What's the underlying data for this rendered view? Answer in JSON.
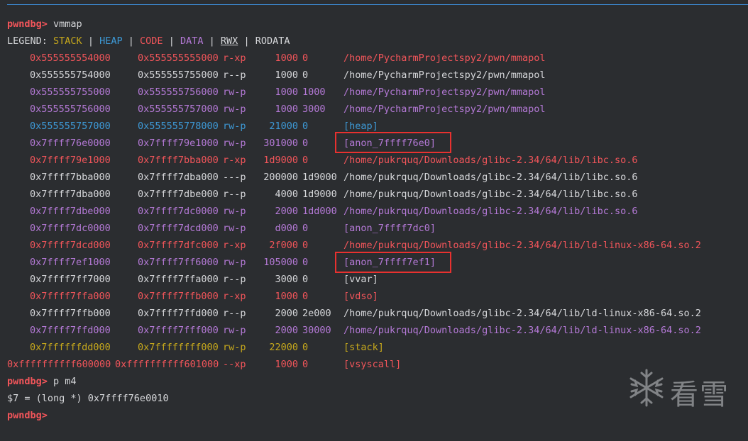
{
  "terminal": {
    "prompt": "pwndbg>",
    "command1": " vmmap",
    "legend": {
      "label": "LEGEND:",
      "stack": "STACK",
      "heap": "HEAP",
      "code": "CODE",
      "data": "DATA",
      "rwx": "RWX",
      "rodata": "RODATA"
    },
    "mappings": [
      {
        "start": "0x555555554000",
        "end": "0x555555555000",
        "perm": "r-xp",
        "size": "1000",
        "offset": "0",
        "path": "/home/PycharmProjectspy2/pwn/mmapol",
        "kind": "code"
      },
      {
        "start": "0x555555754000",
        "end": "0x555555755000",
        "perm": "r--p",
        "size": "1000",
        "offset": "0",
        "path": "/home/PycharmProjectspy2/pwn/mmapol",
        "kind": "ro"
      },
      {
        "start": "0x555555755000",
        "end": "0x555555756000",
        "perm": "rw-p",
        "size": "1000",
        "offset": "1000",
        "path": "/home/PycharmProjectspy2/pwn/mmapol",
        "kind": "data"
      },
      {
        "start": "0x555555756000",
        "end": "0x555555757000",
        "perm": "rw-p",
        "size": "1000",
        "offset": "3000",
        "path": "/home/PycharmProjectspy2/pwn/mmapol",
        "kind": "data"
      },
      {
        "start": "0x555555757000",
        "end": "0x555555778000",
        "perm": "rw-p",
        "size": "21000",
        "offset": "0",
        "path": "[heap]",
        "kind": "heap"
      },
      {
        "start": "0x7ffff76e0000",
        "end": "0x7ffff79e1000",
        "perm": "rw-p",
        "size": "301000",
        "offset": "0",
        "path": "[anon_7ffff76e0]",
        "kind": "data"
      },
      {
        "start": "0x7ffff79e1000",
        "end": "0x7ffff7bba000",
        "perm": "r-xp",
        "size": "1d9000",
        "offset": "0",
        "path": "/home/pukrquq/Downloads/glibc-2.34/64/lib/libc.so.6",
        "kind": "code"
      },
      {
        "start": "0x7ffff7bba000",
        "end": "0x7ffff7dba000",
        "perm": "---p",
        "size": "200000",
        "offset": "1d9000",
        "path": "/home/pukrquq/Downloads/glibc-2.34/64/lib/libc.so.6",
        "kind": "ro"
      },
      {
        "start": "0x7ffff7dba000",
        "end": "0x7ffff7dbe000",
        "perm": "r--p",
        "size": "4000",
        "offset": "1d9000",
        "path": "/home/pukrquq/Downloads/glibc-2.34/64/lib/libc.so.6",
        "kind": "ro"
      },
      {
        "start": "0x7ffff7dbe000",
        "end": "0x7ffff7dc0000",
        "perm": "rw-p",
        "size": "2000",
        "offset": "1dd000",
        "path": "/home/pukrquq/Downloads/glibc-2.34/64/lib/libc.so.6",
        "kind": "data"
      },
      {
        "start": "0x7ffff7dc0000",
        "end": "0x7ffff7dcd000",
        "perm": "rw-p",
        "size": "d000",
        "offset": "0",
        "path": "[anon_7ffff7dc0]",
        "kind": "data"
      },
      {
        "start": "0x7ffff7dcd000",
        "end": "0x7ffff7dfc000",
        "perm": "r-xp",
        "size": "2f000",
        "offset": "0",
        "path": "/home/pukrquq/Downloads/glibc-2.34/64/lib/ld-linux-x86-64.so.2",
        "kind": "code"
      },
      {
        "start": "0x7ffff7ef1000",
        "end": "0x7ffff7ff6000",
        "perm": "rw-p",
        "size": "105000",
        "offset": "0",
        "path": "[anon_7ffff7ef1]",
        "kind": "data"
      },
      {
        "start": "0x7ffff7ff7000",
        "end": "0x7ffff7ffa000",
        "perm": "r--p",
        "size": "3000",
        "offset": "0",
        "path": "[vvar]",
        "kind": "ro"
      },
      {
        "start": "0x7ffff7ffa000",
        "end": "0x7ffff7ffb000",
        "perm": "r-xp",
        "size": "1000",
        "offset": "0",
        "path": "[vdso]",
        "kind": "code"
      },
      {
        "start": "0x7ffff7ffb000",
        "end": "0x7ffff7ffd000",
        "perm": "r--p",
        "size": "2000",
        "offset": "2e000",
        "path": "/home/pukrquq/Downloads/glibc-2.34/64/lib/ld-linux-x86-64.so.2",
        "kind": "ro"
      },
      {
        "start": "0x7ffff7ffd000",
        "end": "0x7ffff7fff000",
        "perm": "rw-p",
        "size": "2000",
        "offset": "30000",
        "path": "/home/pukrquq/Downloads/glibc-2.34/64/lib/ld-linux-x86-64.so.2",
        "kind": "data"
      },
      {
        "start": "0x7ffffffdd000",
        "end": "0x7ffffffff000",
        "perm": "rw-p",
        "size": "22000",
        "offset": "0",
        "path": "[stack]",
        "kind": "stack"
      },
      {
        "start": "0xffffffffff600000",
        "end": "0xffffffffff601000",
        "perm": "--xp",
        "size": "1000",
        "offset": "0",
        "path": "[vsyscall]",
        "kind": "code"
      }
    ],
    "command2": " p m4",
    "result": "$7 = (long *) 0x7ffff76e0010",
    "watermark_text": "看雪",
    "colors": {
      "code": "#f2555a",
      "data": "#b479d6",
      "heap": "#3d99d6",
      "stack": "#c6a81c",
      "highlight": "#e8312f"
    }
  }
}
